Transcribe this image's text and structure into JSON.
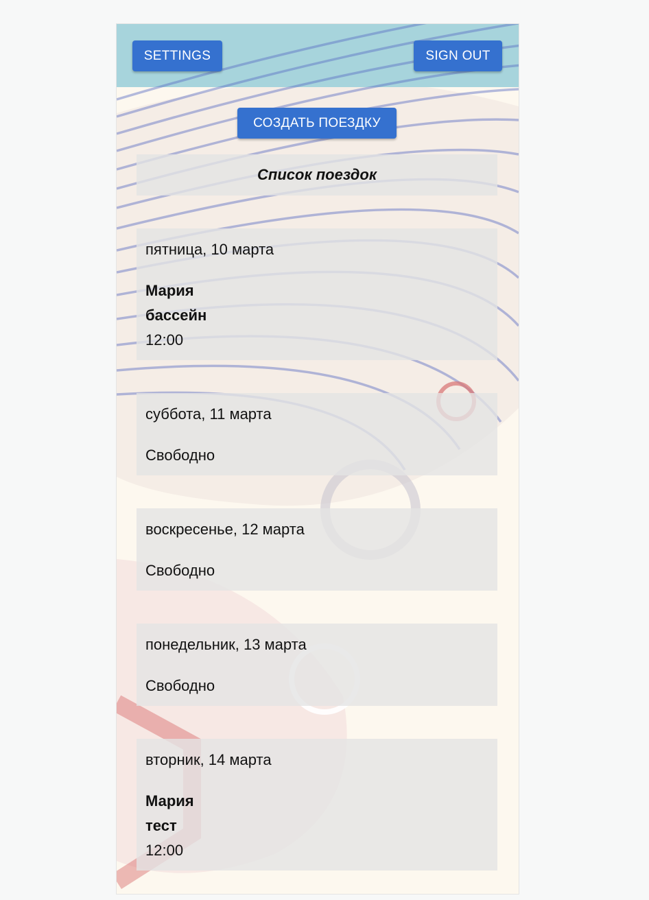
{
  "header": {
    "settings_label": "SETTINGS",
    "signout_label": "SIGN OUT"
  },
  "create_trip_label": "СОЗДАТЬ ПОЕЗДКУ",
  "list_title": "Список поездок",
  "trips": [
    {
      "date": "пятница, 10 марта",
      "name": "Мария",
      "place": "бассейн",
      "time": "12:00"
    },
    {
      "date": "суббота, 11 марта",
      "status": "Свободно"
    },
    {
      "date": "воскресенье, 12 марта",
      "status": "Свободно"
    },
    {
      "date": "понедельник, 13 марта",
      "status": "Свободно"
    },
    {
      "date": "вторник, 14 марта",
      "name": "Мария",
      "place": "тест",
      "time": "12:00"
    }
  ],
  "colors": {
    "button": "#3571cf",
    "header_band": "#a7d4dc",
    "background": "#fdf8ef",
    "card": "#e4e4e4",
    "line_art": "#5b6fc4",
    "accent_red": "#d66b6b"
  }
}
